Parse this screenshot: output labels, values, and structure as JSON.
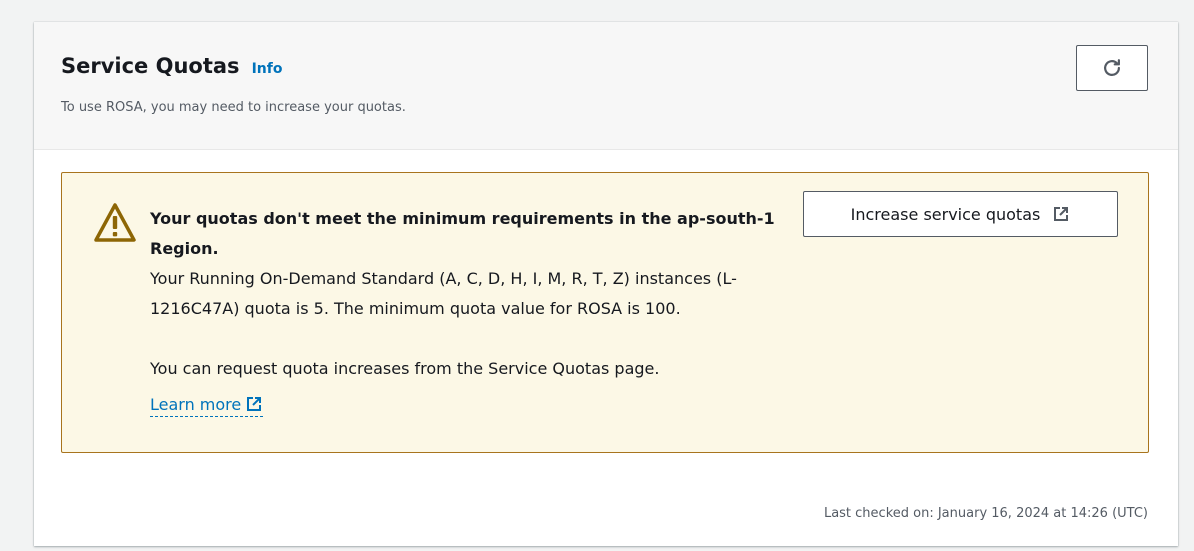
{
  "panel": {
    "title": "Service Quotas",
    "info_label": "Info",
    "subtitle": "To use ROSA, you may need to increase your quotas."
  },
  "alert": {
    "heading": "Your quotas don't meet the minimum requirements in the ap-south-1 Region.",
    "detail": "Your Running On-Demand Standard (A, C, D, H, I, M, R, T, Z) instances (L-1216C47A) quota is 5. The minimum quota value for ROSA is 100.",
    "request_text": "You can request quota increases from the Service Quotas page.",
    "learn_more_label": "Learn more",
    "action_button_label": "Increase service quotas",
    "icon": "warning-icon"
  },
  "footer": {
    "last_checked": "Last checked on: January 16, 2024 at 14:26 (UTC)"
  },
  "colors": {
    "link": "#0073bb",
    "alert_background": "#fcf8e6",
    "alert_border": "#a8741d",
    "warning_icon": "#8d6605"
  }
}
